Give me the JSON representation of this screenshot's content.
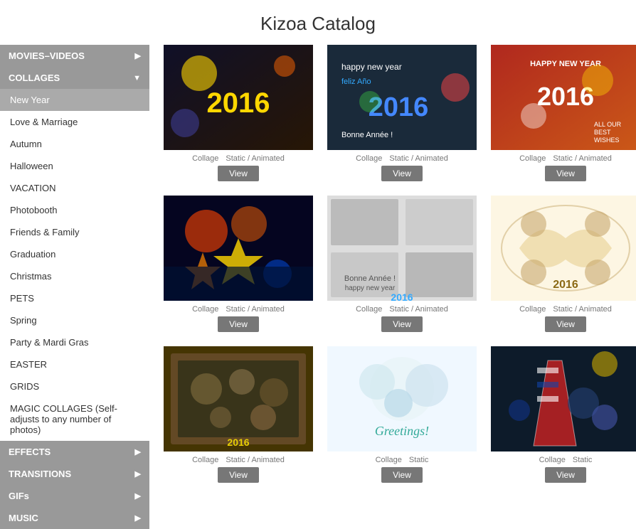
{
  "page": {
    "title": "Kizoa Catalog"
  },
  "sidebar": {
    "categories": [
      {
        "id": "movies",
        "label": "MOVIES–VIDEOS",
        "type": "category",
        "hasArrow": true,
        "expanded": false
      },
      {
        "id": "collages",
        "label": "COLLAGES",
        "type": "category",
        "hasArrow": true,
        "expanded": true
      },
      {
        "id": "new-year",
        "label": "New Year",
        "type": "sub",
        "active": true
      },
      {
        "id": "love-marriage",
        "label": "Love & Marriage",
        "type": "sub"
      },
      {
        "id": "autumn",
        "label": "Autumn",
        "type": "sub"
      },
      {
        "id": "halloween",
        "label": "Halloween",
        "type": "sub"
      },
      {
        "id": "vacation",
        "label": "VACATION",
        "type": "sub"
      },
      {
        "id": "photobooth",
        "label": "Photobooth",
        "type": "sub"
      },
      {
        "id": "friends-family",
        "label": "Friends & Family",
        "type": "sub"
      },
      {
        "id": "graduation",
        "label": "Graduation",
        "type": "sub"
      },
      {
        "id": "christmas",
        "label": "Christmas",
        "type": "sub"
      },
      {
        "id": "pets",
        "label": "PETS",
        "type": "sub"
      },
      {
        "id": "spring",
        "label": "Spring",
        "type": "sub"
      },
      {
        "id": "party-mardi-gras",
        "label": "Party & Mardi Gras",
        "type": "sub"
      },
      {
        "id": "easter",
        "label": "EASTER",
        "type": "sub"
      },
      {
        "id": "grids",
        "label": "GRIDS",
        "type": "sub"
      },
      {
        "id": "magic-collages",
        "label": "MAGIC COLLAGES (Self-adjusts to any number of photos)",
        "type": "sub"
      },
      {
        "id": "effects",
        "label": "EFFECTS",
        "type": "category",
        "hasArrow": true
      },
      {
        "id": "transitions",
        "label": "TRANSITIONS",
        "type": "category",
        "hasArrow": true
      },
      {
        "id": "gifs",
        "label": "GIFs",
        "type": "category",
        "hasArrow": true
      },
      {
        "id": "music",
        "label": "MUSIC",
        "type": "category",
        "hasArrow": true
      }
    ]
  },
  "grid": {
    "items": [
      {
        "id": 1,
        "imgClass": "img1",
        "label": "Collage",
        "type": "Static / Animated",
        "showView": true,
        "viewLabel": "View"
      },
      {
        "id": 2,
        "imgClass": "img2",
        "label": "Collage",
        "type": "Static / Animated",
        "showView": true,
        "viewLabel": "View"
      },
      {
        "id": 3,
        "imgClass": "img3",
        "label": "Collage",
        "type": "Static / Animated",
        "showView": true,
        "viewLabel": "View"
      },
      {
        "id": 4,
        "imgClass": "img4",
        "label": "Collage",
        "type": "Static / Animated",
        "showView": true,
        "viewLabel": "View"
      },
      {
        "id": 5,
        "imgClass": "img5",
        "label": "Collage",
        "type": "Static / Animated",
        "showView": true,
        "viewLabel": "View"
      },
      {
        "id": 6,
        "imgClass": "img6",
        "label": "Collage",
        "type": "Static / Animated",
        "showView": true,
        "viewLabel": "View"
      },
      {
        "id": 7,
        "imgClass": "img7",
        "label": "Collage",
        "type": "Static / Animated",
        "showView": true,
        "viewLabel": "View"
      },
      {
        "id": 8,
        "imgClass": "img8",
        "label": "Collage",
        "type": "Static",
        "showView": true,
        "viewLabel": "View"
      },
      {
        "id": 9,
        "imgClass": "img9",
        "label": "Collage",
        "type": "Static",
        "showView": true,
        "viewLabel": "View"
      }
    ]
  },
  "labels": {
    "collage": "Collage",
    "staticAnimated": "Static / Animated",
    "static": "Static",
    "view": "View"
  }
}
